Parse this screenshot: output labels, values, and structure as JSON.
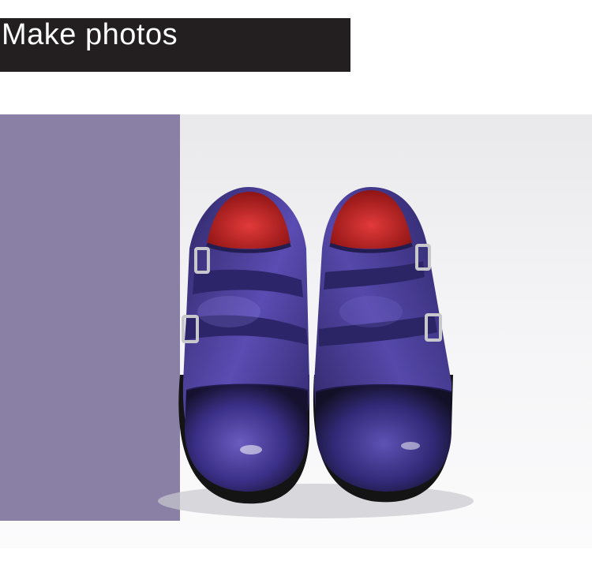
{
  "banner": {
    "title": "Make photos",
    "background": "#231f20",
    "text_color": "#ffffff"
  },
  "photo": {
    "subject": "pair-of-double-monk-strap-shoes",
    "accent_panel_color": "#8a80a6",
    "shoe_color": "#4a3e9a",
    "lining_color": "#d42a2a",
    "buckle_color": "#c8c8cc"
  }
}
